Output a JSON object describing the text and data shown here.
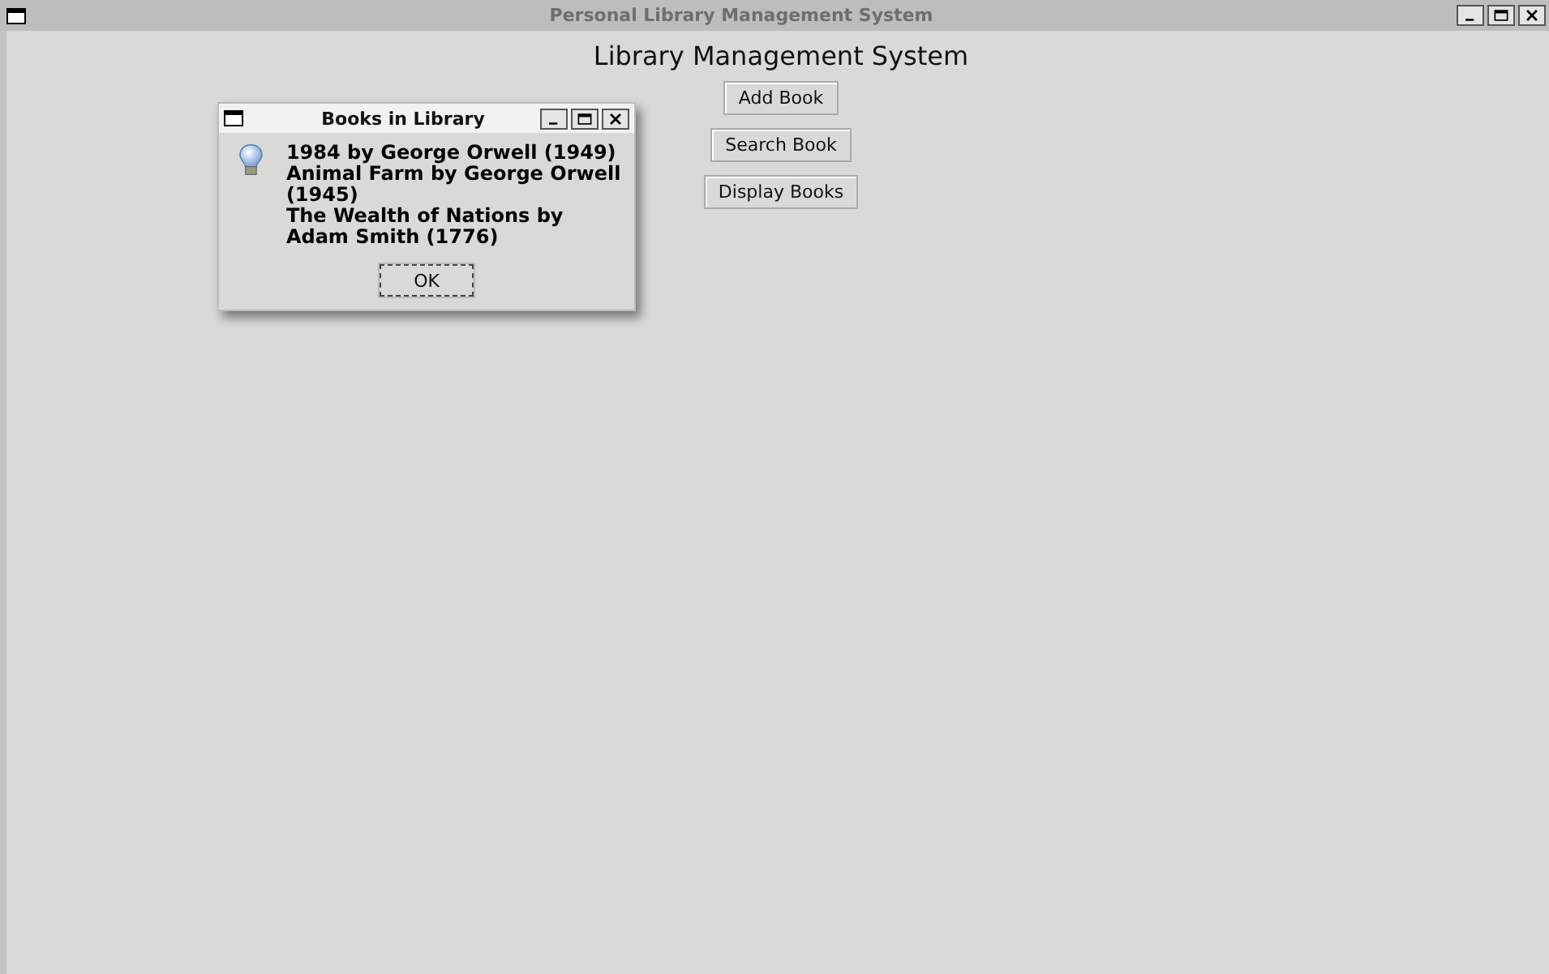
{
  "window": {
    "title": "Personal Library Management System"
  },
  "heading": "Library Management System",
  "buttons": [
    "Add Book",
    "Search Book",
    "Display Books"
  ],
  "dialog": {
    "title": "Books in Library",
    "books": [
      "1984 by George Orwell (1949)",
      "Animal Farm by George Orwell (1945)",
      "The Wealth of Nations by Adam Smith (1776)"
    ],
    "button": "OK"
  }
}
